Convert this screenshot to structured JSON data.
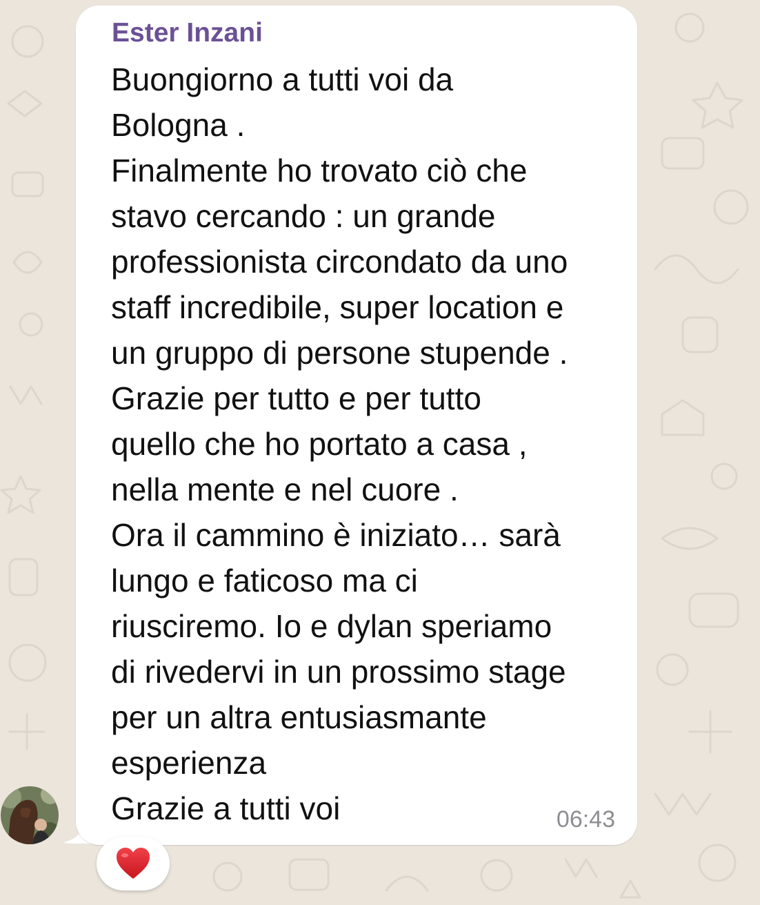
{
  "chat": {
    "message": {
      "sender_name": "Ester Inzani",
      "sender_color": "#6b5096",
      "lines": [
        "Buongiorno a tutti voi da",
        "Bologna .",
        "Finalmente ho trovato ciò che",
        "stavo cercando : un grande",
        "professionista circondato da uno",
        "staff incredibile, super location e",
        "un gruppo di persone stupende .",
        "Grazie per tutto e per tutto",
        "quello che ho portato a casa ,",
        "nella mente e nel cuore .",
        "Ora il cammino è iniziato… sarà",
        "lungo e faticoso ma ci",
        "riusciremo. Io e dylan speriamo",
        "di rivedervi in un prossimo stage",
        "per un altra entusiasmante",
        "esperienza",
        "Grazie a tutti voi"
      ],
      "time": "06:43",
      "avatar_icon": "user-photo-avatar",
      "reaction_icon": "red-heart-icon",
      "reaction_color": "#e0282e"
    }
  }
}
